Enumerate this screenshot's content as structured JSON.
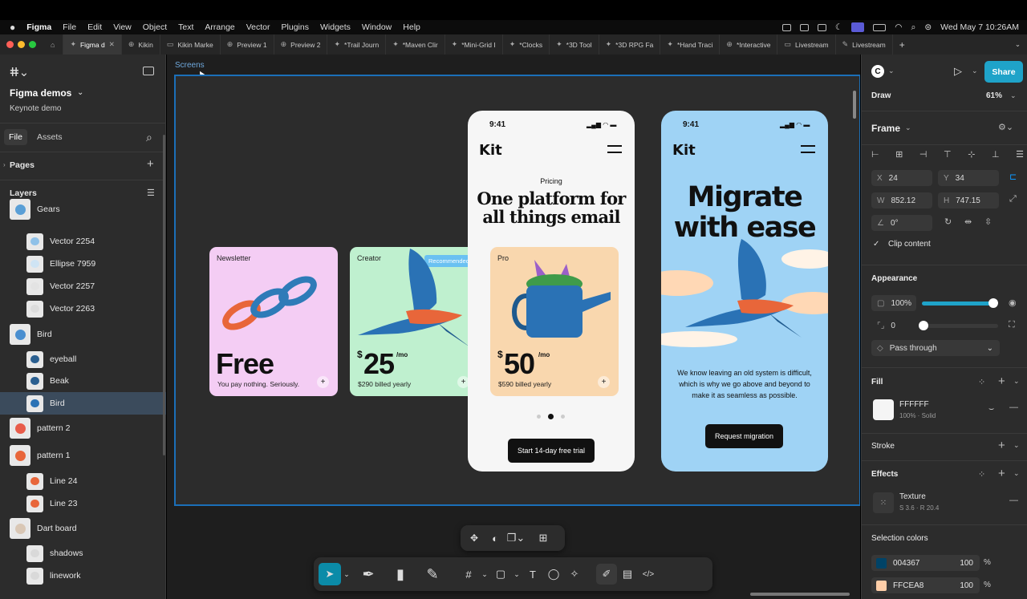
{
  "menubar": {
    "apple": "",
    "items": [
      "Figma",
      "File",
      "Edit",
      "View",
      "Object",
      "Text",
      "Arrange",
      "Vector",
      "Plugins",
      "Widgets",
      "Window",
      "Help"
    ],
    "datetime": "Wed May 7  10:26AM"
  },
  "tabs": [
    {
      "label": "Figma d",
      "icon": "✦",
      "active": true
    },
    {
      "label": "Kikin",
      "icon": "⊕"
    },
    {
      "label": "Kikin Marke",
      "icon": "▭"
    },
    {
      "label": "Preview 1",
      "icon": "⊕"
    },
    {
      "label": "Preview 2",
      "icon": "⊕"
    },
    {
      "label": "*Trail Journ",
      "icon": "✦"
    },
    {
      "label": "*Maven Clir",
      "icon": "✦"
    },
    {
      "label": "*Mini-Grid I",
      "icon": "✦"
    },
    {
      "label": "*Clocks",
      "icon": "✦"
    },
    {
      "label": "*3D Tool",
      "icon": "✦"
    },
    {
      "label": "*3D RPG Fa",
      "icon": "✦"
    },
    {
      "label": "*Hand Traci",
      "icon": "✦"
    },
    {
      "label": "*Interactive",
      "icon": "⊕"
    },
    {
      "label": "Livestream",
      "icon": "▭"
    },
    {
      "label": "Livestream",
      "icon": "✎"
    }
  ],
  "left": {
    "project": "Figma demos",
    "subtitle": "Keynote demo",
    "file_tab": "File",
    "assets_tab": "Assets",
    "pages": "Pages",
    "layers": "Layers",
    "layer_items": [
      {
        "name": "Gears",
        "indent": 0
      },
      {
        "name": "Vector 2254",
        "indent": 1
      },
      {
        "name": "Ellipse 7959",
        "indent": 1
      },
      {
        "name": "Vector 2257",
        "indent": 1
      },
      {
        "name": "Vector 2263",
        "indent": 1
      },
      {
        "name": "Bird",
        "indent": 0
      },
      {
        "name": "eyeball",
        "indent": 1
      },
      {
        "name": "Beak",
        "indent": 1
      },
      {
        "name": "Bird",
        "indent": 1,
        "selected": true
      },
      {
        "name": "pattern 2",
        "indent": 0
      },
      {
        "name": "pattern 1",
        "indent": 0
      },
      {
        "name": "Line 24",
        "indent": 1
      },
      {
        "name": "Line 23",
        "indent": 1
      },
      {
        "name": "Dart board",
        "indent": 0
      },
      {
        "name": "shadows",
        "indent": 1
      },
      {
        "name": "linework",
        "indent": 1
      }
    ]
  },
  "canvas": {
    "frame_label": "Screens",
    "cards": {
      "newsletter": {
        "label": "Newsletter",
        "price": "Free",
        "note": "You pay nothing. Seriously."
      },
      "creator": {
        "label": "Creator",
        "badge": "Recommended",
        "currency": "$",
        "price": "25",
        "per": "/mo",
        "note": "$290 billed yearly"
      },
      "pro": {
        "label": "Pro",
        "currency": "$",
        "price": "50",
        "per": "/mo",
        "note": "$590 billed yearly"
      }
    },
    "phone1": {
      "time": "9:41",
      "brand": "Kit",
      "eyebrow": "Pricing",
      "headline1": "One platform for",
      "headline2": "all things email",
      "cta": "Start 14-day free trial"
    },
    "phone2": {
      "time": "9:41",
      "brand": "Kit",
      "headline1": "Migrate",
      "headline2": "with ease",
      "body1": "We know leaving an old system is difficult,",
      "body2": "which is why we go above and beyond to",
      "body3": "make it as seamless as possible.",
      "cta": "Request migration"
    }
  },
  "right": {
    "share": "Share",
    "draw": "Draw",
    "zoom": "61%",
    "frame": "Frame",
    "x_label": "X",
    "x": "24",
    "y_label": "Y",
    "y": "34",
    "w_label": "W",
    "w": "852.12",
    "h_label": "H",
    "h": "747.15",
    "rotation": "0°",
    "clip": "Clip content",
    "appearance": "Appearance",
    "opacity": "100%",
    "radius": "0",
    "blend": "Pass through",
    "fill": "Fill",
    "fill_hex": "FFFFFF",
    "fill_sub": "100% · Solid",
    "stroke": "Stroke",
    "effects": "Effects",
    "effect_name": "Texture",
    "effect_sub": "S 3.6 · R 20.4",
    "selection_colors": "Selection colors",
    "colors": [
      {
        "hex": "004367",
        "pct": "100",
        "unit": "%",
        "swatch": "#004367"
      },
      {
        "hex": "FFCEA8",
        "pct": "100",
        "unit": "%",
        "swatch": "#FFCEA8"
      }
    ]
  },
  "colors": {
    "accent": "#0d99ff",
    "frame_outline": "#1b6fb8",
    "share": "#1fa3c9"
  }
}
